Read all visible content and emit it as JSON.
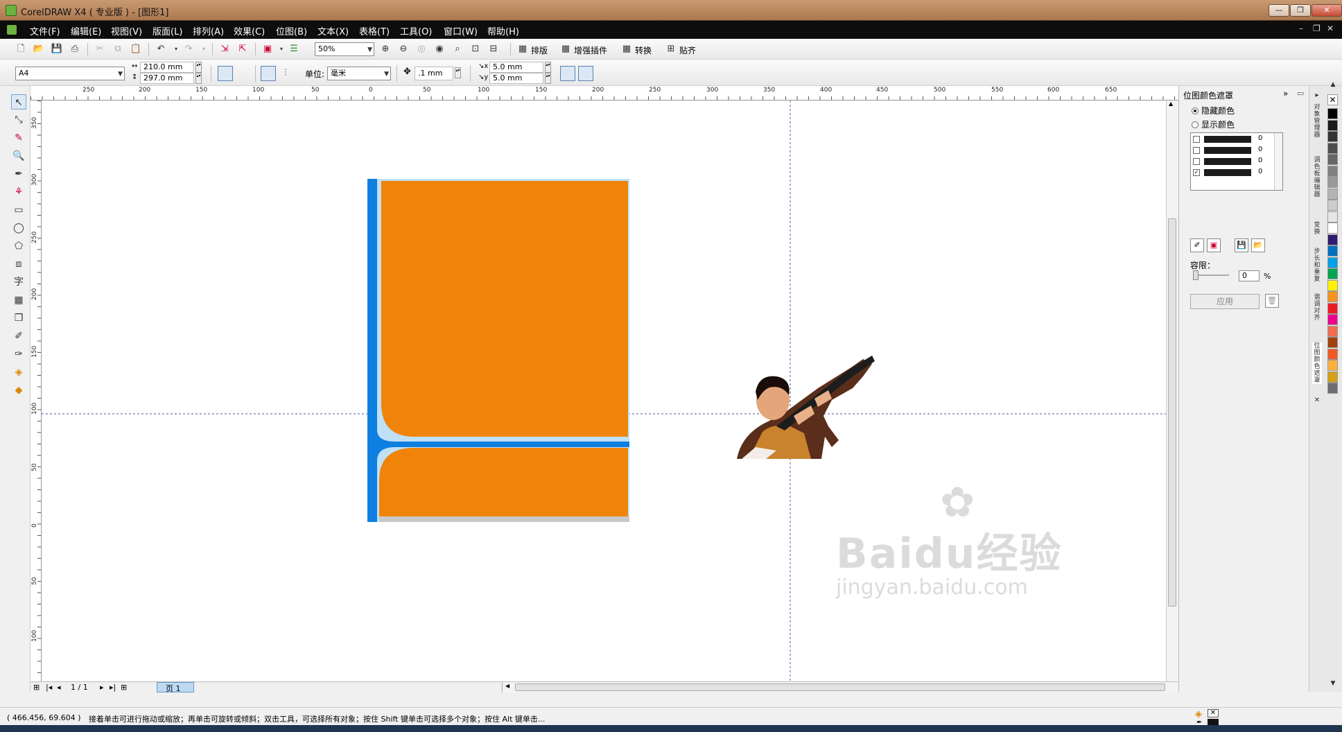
{
  "window": {
    "title": "CorelDRAW X4 ( 专业版 ) - [图形1]"
  },
  "menu": [
    "文件(F)",
    "编辑(E)",
    "视图(V)",
    "版面(L)",
    "排列(A)",
    "效果(C)",
    "位图(B)",
    "文本(X)",
    "表格(T)",
    "工具(O)",
    "窗口(W)",
    "帮助(H)"
  ],
  "toolbar": {
    "zoom": "50%",
    "layout": "排版",
    "plugin": "增强插件",
    "convert": "转换",
    "snap": "贴齐"
  },
  "propbar": {
    "page_size": "A4",
    "width": "210.0 mm",
    "height": "297.0 mm",
    "unit_label": "单位:",
    "unit": "毫米",
    "nudge": ".1 mm",
    "dup_x": "5.0 mm",
    "dup_y": "5.0 mm"
  },
  "hruler": [
    "250",
    "200",
    "150",
    "100",
    "50",
    "0",
    "50",
    "100",
    "150",
    "200",
    "250",
    "300",
    "350",
    "400",
    "450",
    "500",
    "550",
    "600",
    "650"
  ],
  "vruler": [
    "350",
    "300",
    "250",
    "200",
    "150",
    "100",
    "50",
    "0",
    "50",
    "100"
  ],
  "pagebar": {
    "count": "1 / 1",
    "tab": "页 1"
  },
  "status": {
    "coords": "( 466.456, 69.604 )",
    "hint": "接着单击可进行拖动或缩放；再单击可旋转或倾斜；双击工具，可选择所有对象；按住 Shift 键单击可选择多个对象；按住 Alt 键单击..."
  },
  "docker": {
    "title": "位图颜色遮罩",
    "hide": "隐藏颜色",
    "show": "显示颜色",
    "rows": [
      {
        "checked": false,
        "v": "0"
      },
      {
        "checked": false,
        "v": "0"
      },
      {
        "checked": false,
        "v": "0"
      },
      {
        "checked": true,
        "v": "0"
      }
    ],
    "tolerance_label": "容限：",
    "tolerance": "0",
    "percent": "%",
    "apply": "应用"
  },
  "side_tabs": [
    "对象管理器",
    "调色板编辑器",
    "变换",
    "步长和重复",
    "谐调对齐",
    "位图颜色遮罩"
  ],
  "watermark": {
    "main": "Baidu经验",
    "sub": "jingyan.baidu.com"
  },
  "palette_colors": [
    "#000000",
    "#1a1a1a",
    "#333333",
    "#4d4d4d",
    "#666666",
    "#808080",
    "#999999",
    "#b3b3b3",
    "#cccccc",
    "#e6e6e6",
    "#ffffff",
    "#2e1a6e",
    "#0070c0",
    "#00a0e9",
    "#00a651",
    "#fff200",
    "#f7941d",
    "#ed1c24",
    "#ec008c",
    "#f26c4f",
    "#a0410d",
    "#f15a24",
    "#fbb040",
    "#d4a017",
    "#6d6e71"
  ],
  "colors": {
    "orange": "#f0840a",
    "blue": "#0e7fe0",
    "light_blue": "#bfe0f7"
  }
}
